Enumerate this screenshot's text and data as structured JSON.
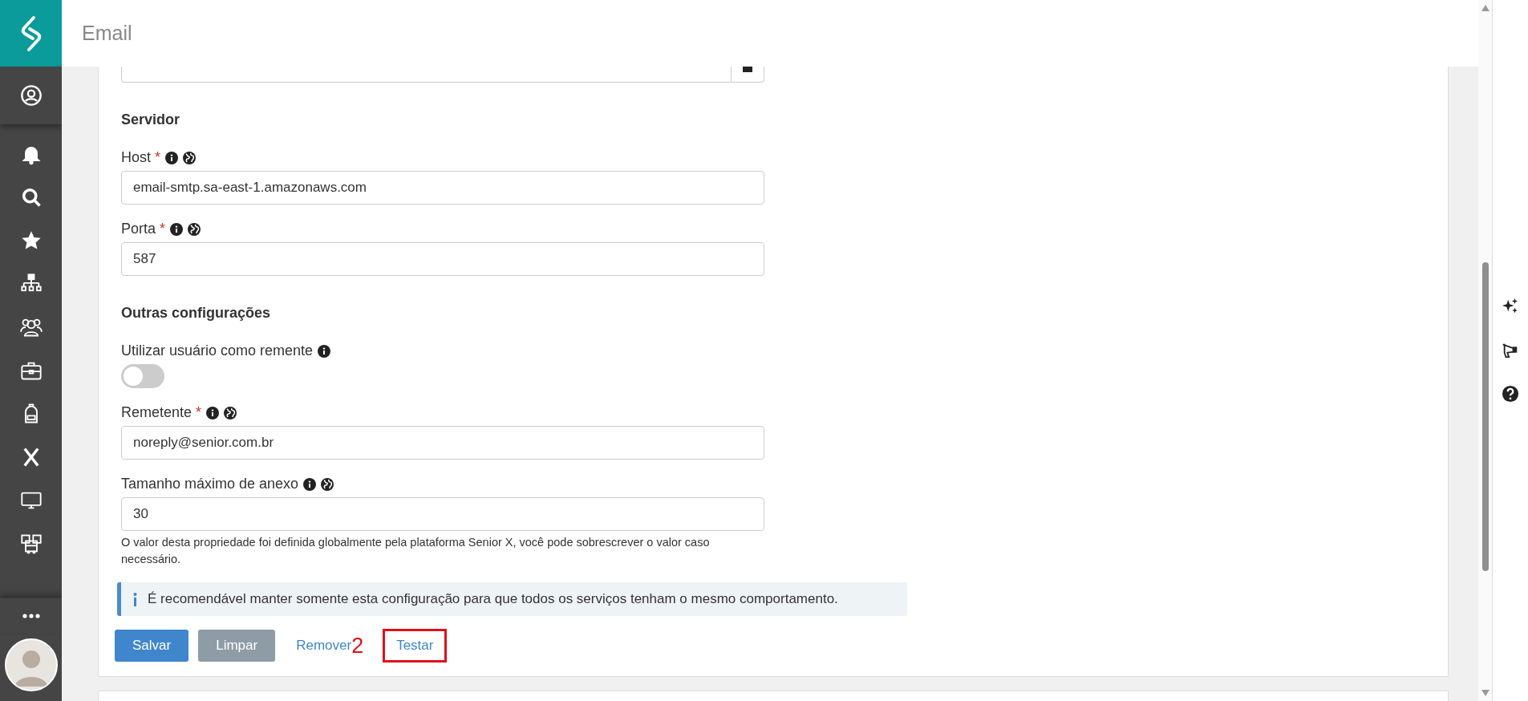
{
  "header": {
    "title": "Email"
  },
  "sections": [
    {
      "title": "Servidor",
      "fields": [
        {
          "kind": "text",
          "label": "Host",
          "required": "*",
          "info": true,
          "global": true,
          "value": "email-smtp.sa-east-1.amazonaws.com"
        },
        {
          "kind": "text",
          "label": "Porta",
          "required": "*",
          "info": true,
          "global": true,
          "value": "587"
        }
      ]
    },
    {
      "title": "Outras configurações",
      "fields": [
        {
          "kind": "toggle",
          "label": "Utilizar usuário como remente",
          "info": true,
          "global": false,
          "on": false
        },
        {
          "kind": "text",
          "label": "Remetente",
          "required": "*",
          "info": true,
          "global": true,
          "value": "noreply@senior.com.br"
        },
        {
          "kind": "text",
          "label": "Tamanho máximo de anexo",
          "info": true,
          "global": true,
          "value": "30",
          "help": "O valor desta propriedade foi definida globalmente pela plataforma Senior X, você pode sobrescrever o valor caso necessário."
        }
      ]
    }
  ],
  "banner": {
    "text": "É recomendável manter somente esta configuração para que todos os serviços tenham o mesmo comportamento."
  },
  "actions": [
    {
      "kind": "primary",
      "label": "Salvar",
      "disabled": false
    },
    {
      "kind": "primary",
      "label": "Limpar",
      "disabled": true
    },
    {
      "kind": "link",
      "label": "Remover",
      "highlighted": false,
      "annotation": "2"
    },
    {
      "kind": "link",
      "label": "Testar",
      "highlighted": true
    }
  ]
}
